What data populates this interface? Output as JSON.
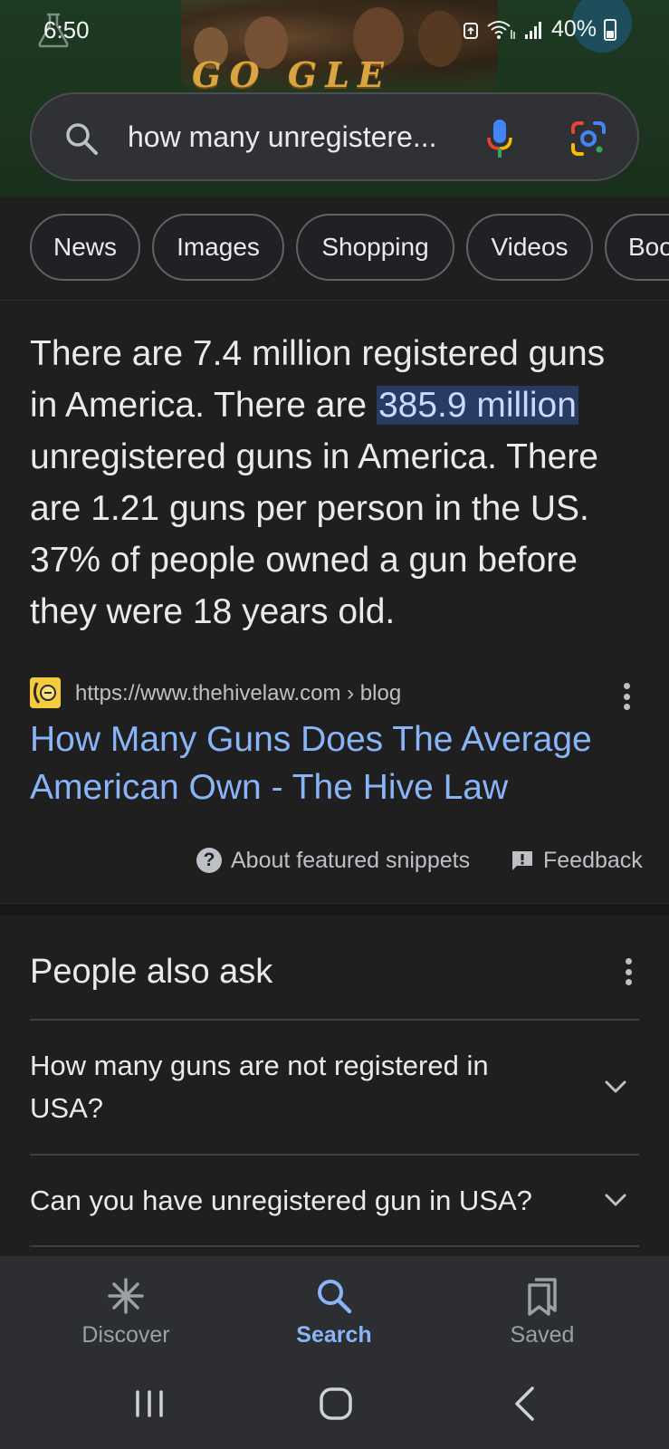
{
  "status_bar": {
    "time": "6:50",
    "battery": "40%"
  },
  "doodle": {
    "word": "GO  GLE"
  },
  "search": {
    "query": "how many unregistere..."
  },
  "chips": [
    {
      "label": "News"
    },
    {
      "label": "Images"
    },
    {
      "label": "Shopping"
    },
    {
      "label": "Videos"
    },
    {
      "label": "Boo"
    }
  ],
  "snippet": {
    "text_before": "There are 7.4 million registered guns in America. There are ",
    "highlight": "385.9 million",
    "text_after": " unregistered guns in America. There are 1.21 guns per person in the US. 37% of people owned a gun before they were 18 years old."
  },
  "source": {
    "url": "https://www.thehivelaw.com › blog",
    "title": "How Many Guns Does The Average American Own - The Hive Law"
  },
  "snippet_footer": {
    "about": "About featured snippets",
    "feedback": "Feedback"
  },
  "people_also_ask": {
    "title": "People also ask",
    "questions": [
      "How many guns are not registered in USA?",
      "Can you have unregistered gun in USA?"
    ]
  },
  "bottom_nav": {
    "items": [
      {
        "label": "Discover",
        "icon": "asterisk-icon"
      },
      {
        "label": "Search",
        "icon": "search-icon"
      },
      {
        "label": "Saved",
        "icon": "bookmarks-icon"
      }
    ],
    "active_index": 1
  },
  "colors": {
    "background": "#1f1f1f",
    "link": "#8ab4f8",
    "highlight_bg": "#273c60",
    "text": "#e8eaed",
    "secondary_text": "#bdc1c6"
  }
}
